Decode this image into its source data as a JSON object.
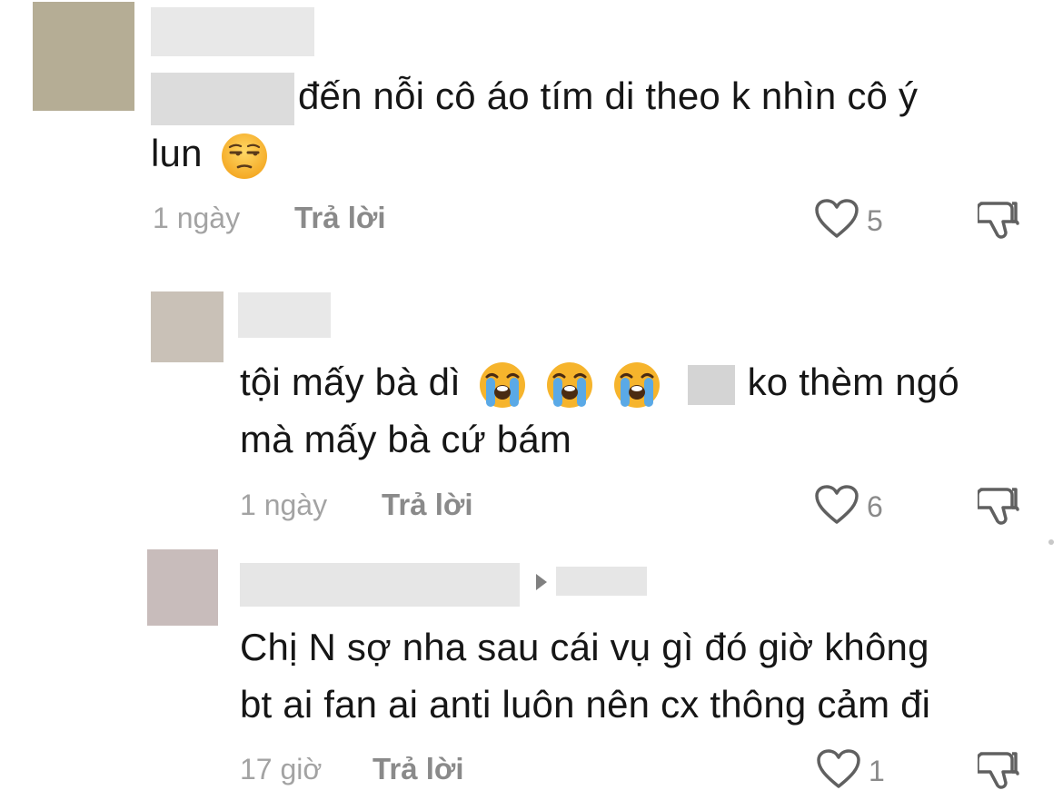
{
  "comments": [
    {
      "text_line1_after_blur": "đến nỗi cô áo tím di theo k nhìn cô ý",
      "text_line2": "lun",
      "emoji": "unamused-face-emoji",
      "time": "1 ngày",
      "reply_label": "Trả lời",
      "like_count": "5"
    },
    {
      "text_line1_start": "tội mấy bà dì",
      "text_line1_end": "ko thèm ngó",
      "text_line2": "mà mấy bà cứ bám",
      "emoji": "loudly-crying-face-emoji",
      "time": "1 ngày",
      "reply_label": "Trả lời",
      "like_count": "6"
    },
    {
      "text_line1": "Chị N sợ nha sau cái vụ gì đó giờ không",
      "text_line2": "bt ai fan ai anti luôn nên cx thông cảm đi",
      "time": "17 giờ",
      "reply_label": "Trả lời",
      "like_count": "1"
    }
  ],
  "colors": {
    "avatar1": "#b5ad95",
    "avatar2": "#c9c1b7",
    "avatar3": "#c8bcbb",
    "blur": "#e6e6e6",
    "meta_text": "#a3a3a3",
    "reply_text": "#8a8a8a"
  }
}
